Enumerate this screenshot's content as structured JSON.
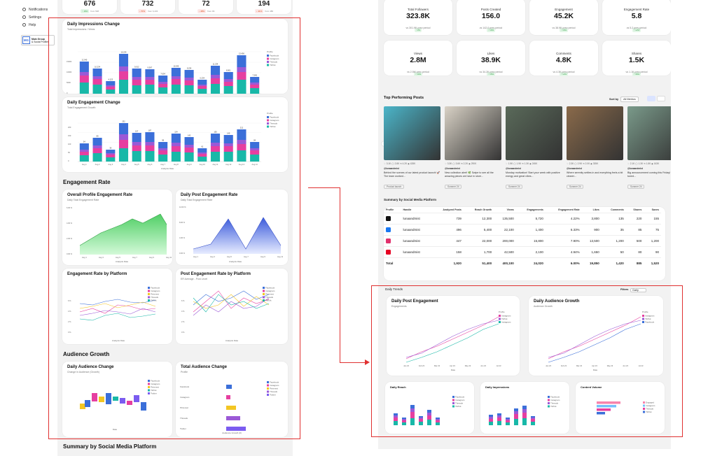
{
  "sidebar": {
    "items": [
      {
        "label": "Notifications",
        "icon": "bell-icon"
      },
      {
        "label": "Settings",
        "icon": "gear-icon"
      },
      {
        "label": "Help",
        "icon": "help-icon"
      }
    ],
    "section_label": "Main Group",
    "org_name": "Main Group",
    "org_sub": "& Social Profiles",
    "avatar": "MG"
  },
  "left": {
    "top_stats": [
      {
        "value": "676",
        "badge": "↑ 16%",
        "sub": "from 548"
      },
      {
        "value": "732",
        "badge": "↓ 70%",
        "sub": "from 6,433"
      },
      {
        "value": "72",
        "badge": "↓ 48%",
        "sub": "from 99"
      },
      {
        "value": "194",
        "badge": "↓ 41%",
        "sub": "from 486"
      }
    ],
    "impressions": {
      "title": "Daily Impressions Change",
      "subtitle": "Total Impressions / Views",
      "xlabel": "Analysis Date",
      "legend_title": "Profile",
      "legend": [
        "Facebook",
        "Instagram",
        "Threads",
        "TikTok"
      ]
    },
    "engagement_change": {
      "title": "Daily Engagement Change",
      "subtitle": "Total Engagement Growth",
      "xlabel": "Analysis Date",
      "legend_title": "Profile",
      "legend": [
        "Facebook",
        "Instagram",
        "Threads",
        "TikTok"
      ]
    },
    "section_engagement": "Engagement Rate",
    "overall_rate": {
      "title": "Overall Profile Engagement Rate",
      "subtitle": "Daily Total Engagement Rate",
      "xlabel": "Analysis Date"
    },
    "post_rate": {
      "title": "Daily Post Engagement Rate",
      "subtitle": "Daily Total Engagement Rate",
      "xlabel": "Analysis Date"
    },
    "rate_platform": {
      "title": "Engagement Rate by Platform",
      "xlabel": "Analysis Date",
      "legend": [
        "Facebook",
        "Instagram",
        "Pinterest",
        "Threads",
        "TikTok"
      ]
    },
    "post_rate_platform": {
      "title": "Post Engagement Rate by Platform",
      "subtitle": "ER Average - Post Level",
      "xlabel": "Analysis Date",
      "legend": [
        "Facebook",
        "Instagram",
        "Pinterest",
        "Threads",
        "TikTok"
      ]
    },
    "section_audience": "Audience Growth",
    "audience_change": {
      "title": "Daily Audience Change",
      "subtitle": "Change in Audience (Growth)",
      "xlabel": "Date",
      "legend": [
        "Facebook",
        "Instagram",
        "Pinterest",
        "TikTok",
        "Twitter"
      ]
    },
    "total_audience": {
      "title": "Total Audience Change",
      "subtitle": "Profile",
      "xlabel": "Audience Growth (#)",
      "categories": [
        "Facebook",
        "Instagram",
        "Pinterest",
        "Threads",
        "Twitter"
      ],
      "legend": [
        "Facebook",
        "Instagram",
        "Pinterest",
        "Threads",
        "Twitter"
      ]
    },
    "section_summary": "Summary by Social Media Platform"
  },
  "right": {
    "stats_row1": [
      {
        "title": "Total Followers",
        "value": "323.8K",
        "badge": "↑ 2%",
        "sub": "vs 301.9K prev period"
      },
      {
        "title": "Posts Created",
        "value": "156.0",
        "badge": "↑ 10%",
        "sub": "vs 142.0 prev period"
      },
      {
        "title": "Engagement",
        "value": "45.2K",
        "badge": "↑ 16%",
        "sub": "vs 38.9K prev period"
      },
      {
        "title": "Engagement Rate",
        "value": "5.8",
        "badge": "↑ 12%",
        "sub": "vs 5.2 prev period"
      }
    ],
    "stats_row2": [
      {
        "title": "Views",
        "value": "2.8M",
        "badge": "↑ 10%",
        "sub": "vs 2.5M prev period"
      },
      {
        "title": "Likes",
        "value": "38.9K",
        "badge": "↑ 15%",
        "sub": "vs 34.2K prev period"
      },
      {
        "title": "Comments",
        "value": "4.8K",
        "badge": "↑ 12%",
        "sub": "vs 4.3K prev period"
      },
      {
        "title": "Shares",
        "value": "1.5K",
        "badge": "↑ 36%",
        "sub": "vs 1.1K prev period"
      }
    ],
    "top_posts_title": "Top Performing Posts",
    "sort_label": "Sort by",
    "sort_value": "All Metrics",
    "posts": [
      {
        "likes": "♡ 3.1K",
        "comments": "◯ 2.8K",
        "shares": "⟲ 4.2K",
        "views": "◉ 428K",
        "handle": "@lunaandmist",
        "caption": "Behind the scenes of our latest product launch! 🚀 The team worked...",
        "tag": "Product launch",
        "color": "#4bb5c9"
      },
      {
        "likes": "♡ 3.3K",
        "comments": "◯ 3.6K",
        "shares": "⟲ 2.2K",
        "views": "◉ 290K",
        "handle": "@lunaandmist",
        "caption": "New collection alert! 🌿 Swipe to see all the amazing pieces we have in store...",
        "tag": "Summer 24",
        "color": "#d9d2c6"
      },
      {
        "likes": "♡ 1.9K",
        "comments": "◯ 1.9K",
        "shares": "⟲ 1.3K",
        "views": "◉ 245K",
        "handle": "@lunaandmist",
        "caption": "Monday motivation! Start your week with positive energy and great vibes...",
        "tag": "Summer 24",
        "color": "#5a6a5a"
      },
      {
        "likes": "♡ 2.3K",
        "comments": "◯ 2.9K",
        "shares": "⟲ 2.0K",
        "views": "◉ 335K",
        "handle": "@lunaandmist",
        "caption": "Where serenity settles in and everything feels a bit clearer...",
        "tag": "Summer 24",
        "color": "#8a6a4a"
      },
      {
        "likes": "♡ 2.1K",
        "comments": "◯ 1.3K",
        "shares": "⟲ 1.8K",
        "views": "◉ 163K",
        "handle": "@lunaandmist",
        "caption": "Big announcement coming this Friday! Stay tuned...",
        "tag": "Summer 24",
        "color": "#7a9a8a"
      }
    ],
    "summary_title": "Summary by Social Media Platform",
    "summary_headers": [
      "Profile",
      "Handle",
      "Analyzed Posts",
      "Reach Growth",
      "Views",
      "Engagements",
      "Engagement Rate",
      "Likes",
      "Comments",
      "Shares",
      "Saves"
    ],
    "summary_rows": [
      {
        "icon": "tiktok-icon",
        "handle": "lunaandmist",
        "cells": [
          "739",
          "12,300",
          "135,500",
          "5,720",
          "4.22%",
          "3,800",
          "135",
          "220",
          "155"
        ]
      },
      {
        "icon": "facebook-icon",
        "handle": "lunaandmist",
        "cells": [
          "496",
          "5,400",
          "22,100",
          "1,400",
          "6.33%",
          "900",
          "35",
          "85",
          "75"
        ]
      },
      {
        "icon": "instagram-icon",
        "handle": "lunaandmist",
        "cells": [
          "447",
          "22,000",
          "200,000",
          "15,800",
          "7.90%",
          "13,500",
          "1,200",
          "500",
          "1,200"
        ]
      },
      {
        "icon": "pinterest-icon",
        "handle": "lunaandmist",
        "cells": [
          "158",
          "1,700",
          "42,500",
          "2,100",
          "4.94%",
          "1,650",
          "50",
          "80",
          "90"
        ]
      }
    ],
    "summary_total": {
      "label": "Total",
      "cells": [
        "1,920",
        "51,400",
        "400,100",
        "24,020",
        "6.00%",
        "19,850",
        "1,420",
        "885",
        "1,520"
      ]
    },
    "daily_trends": "Daily Trends",
    "filters_label": "Filters",
    "filters_value": "Daily",
    "post_engagement": {
      "title": "Daily Post Engagement",
      "subtitle": "Engagements",
      "xlabel": "Date",
      "xticks": [
        "Jan 23",
        "Feb 23",
        "Mar 23",
        "Apr 23",
        "May 23",
        "Jun 23",
        "Jul 23"
      ],
      "legend_title": "Profile",
      "legend": [
        "Instagram",
        "TikTok",
        "Instagram"
      ]
    },
    "audience_growth": {
      "title": "Daily Audience Growth",
      "subtitle": "Audience Growth",
      "xlabel": "Date",
      "xticks": [
        "Jan 23",
        "Feb 23",
        "Mar 23",
        "Apr 23",
        "May 23",
        "Jun 23",
        "Jul 23"
      ],
      "legend_title": "Profile",
      "legend": [
        "Instagram",
        "TikTok",
        "Facebook"
      ]
    },
    "daily_reach": {
      "title": "Daily Reach"
    },
    "daily_impressions": {
      "title": "Daily Impressions"
    },
    "content_volume": {
      "title": "Content Volume"
    }
  },
  "colors": {
    "facebook": "#3b6fd9",
    "instagram": "#e63fa0",
    "threads": "#9b59d6",
    "tiktok": "#18b8a8",
    "pinterest": "#f3c623",
    "twitter": "#7b5cf0",
    "accent_red": "#e03131"
  }
}
